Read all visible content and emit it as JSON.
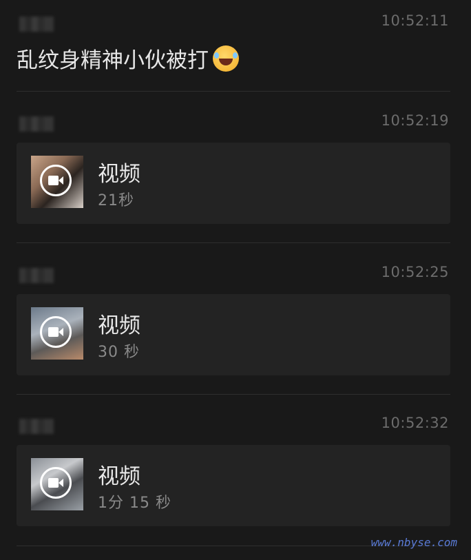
{
  "messages": [
    {
      "timestamp": "10:52:11",
      "text": "乱纹身精神小伙被打",
      "emoji": "laughing-crying-emoji"
    },
    {
      "timestamp": "10:52:19",
      "video_label": "视频",
      "duration": "21秒"
    },
    {
      "timestamp": "10:52:25",
      "video_label": "视频",
      "duration": "30 秒"
    },
    {
      "timestamp": "10:52:32",
      "video_label": "视频",
      "duration": "1分 15 秒"
    }
  ],
  "watermark": "www.nbyse.com",
  "colors": {
    "background": "#191919",
    "card": "#232323",
    "timestamp": "#6c6c6c",
    "text": "#e6e6e6",
    "subtext": "#8a8a8a"
  },
  "icons": {
    "video": "video-camera-icon",
    "emoji": "face-with-tears-of-joy-icon"
  }
}
